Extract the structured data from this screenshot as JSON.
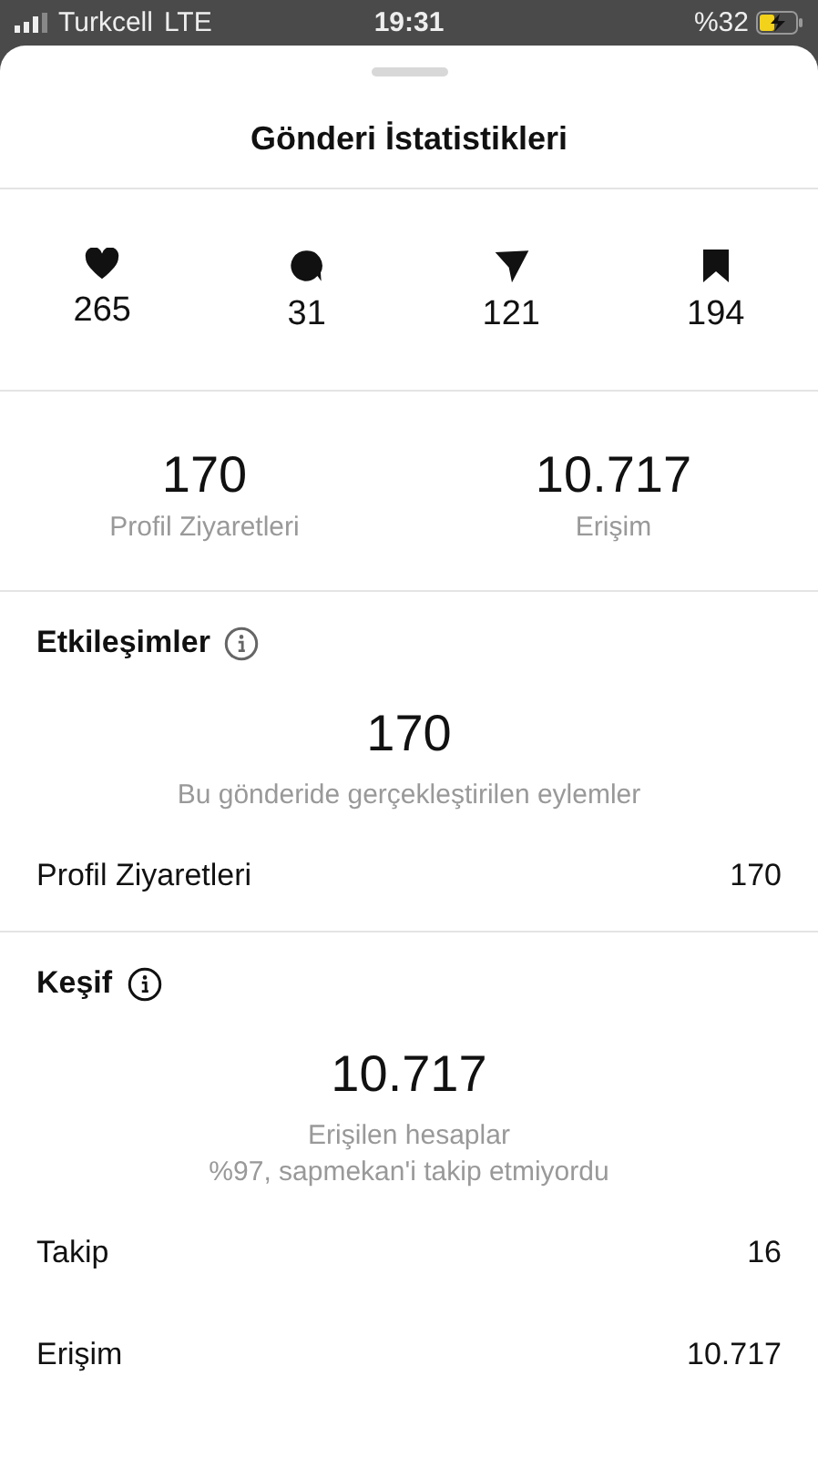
{
  "status_bar": {
    "carrier": "Turkcell",
    "network": "LTE",
    "time": "19:31",
    "battery": "%32"
  },
  "sheet": {
    "title": "Gönderi İstatistikleri"
  },
  "stats": [
    {
      "kind": "like",
      "value": "265"
    },
    {
      "kind": "comment",
      "value": "31"
    },
    {
      "kind": "share",
      "value": "121"
    },
    {
      "kind": "save",
      "value": "194"
    }
  ],
  "metrics": [
    {
      "value": "170",
      "label": "Profil Ziyaretleri"
    },
    {
      "value": "10.717",
      "label": "Erişim"
    }
  ],
  "sections": [
    {
      "title": "Etkileşimler",
      "value": "170",
      "captions": [
        "Bu gönderide gerçekleştirilen eylemler"
      ],
      "rows": [
        {
          "label": "Profil Ziyaretleri",
          "value": "170"
        }
      ]
    },
    {
      "title": "Keşif",
      "value": "10.717",
      "captions": [
        "Erişilen hesaplar",
        "%97, sapmekan'i takip etmiyordu"
      ],
      "rows": [
        {
          "label": "Takip",
          "value": "16"
        },
        {
          "label": "Erişim",
          "value": "10.717"
        }
      ]
    }
  ]
}
